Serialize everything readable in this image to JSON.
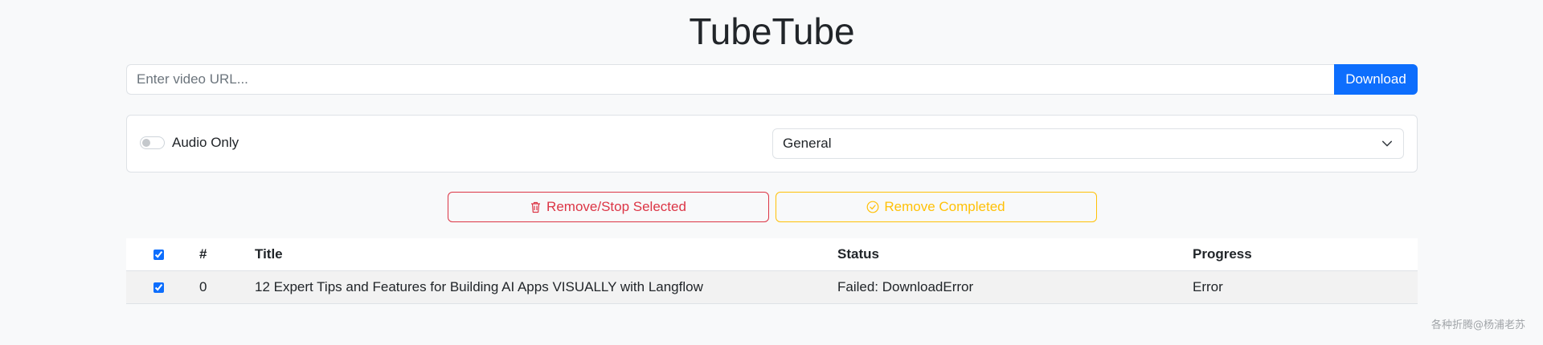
{
  "app": {
    "title": "TubeTube"
  },
  "url_bar": {
    "placeholder": "Enter video URL...",
    "value": "",
    "download_label": "Download"
  },
  "options": {
    "audio_only_label": "Audio Only",
    "audio_only_checked": false,
    "profile_selected": "General"
  },
  "actions": {
    "remove_selected_label": "Remove/Stop Selected",
    "remove_selected_icon": "trash-icon",
    "remove_completed_label": "Remove Completed",
    "remove_completed_icon": "check-circle-icon"
  },
  "table": {
    "headers": {
      "number": "#",
      "title": "Title",
      "status": "Status",
      "progress": "Progress"
    },
    "select_all_checked": true,
    "rows": [
      {
        "checked": true,
        "number": "0",
        "title": "12 Expert Tips and Features for Building AI Apps VISUALLY with Langflow",
        "status": "Failed: DownloadError",
        "progress": "Error"
      }
    ]
  },
  "watermark": "各种折腾@杨浦老苏",
  "colors": {
    "primary": "#0d6efd",
    "danger": "#dc3545",
    "warning": "#ffc107",
    "background": "#f8f9fa"
  }
}
